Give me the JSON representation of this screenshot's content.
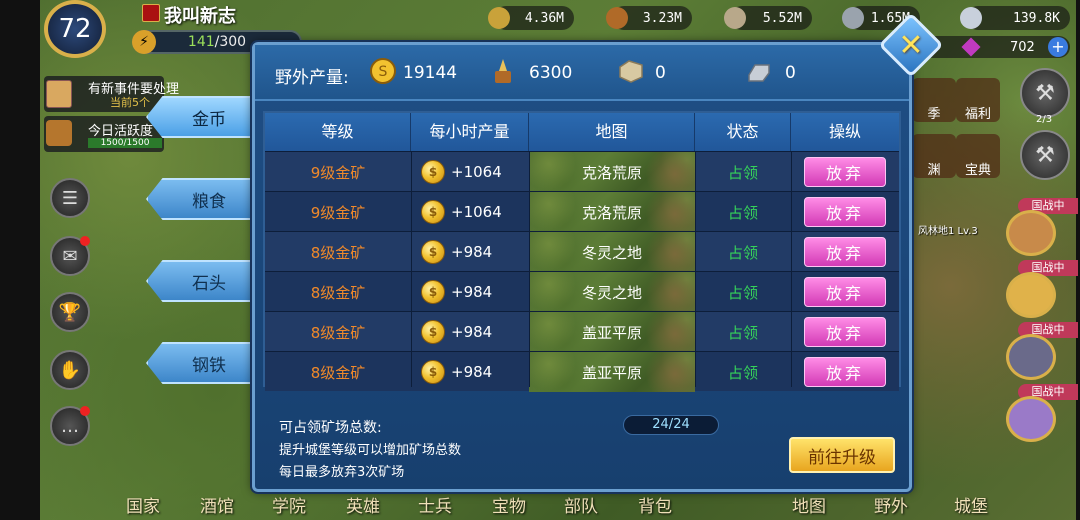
{
  "player": {
    "level": "72",
    "name": "我叫新志",
    "energy_current": "141",
    "energy_max": "/300"
  },
  "resources": [
    {
      "name": "gold",
      "value": "4.36M"
    },
    {
      "name": "food",
      "value": "3.23M"
    },
    {
      "name": "stone",
      "value": "5.52M"
    },
    {
      "name": "iron",
      "value": "1.65M"
    },
    {
      "name": "silver",
      "value": "139.8K"
    }
  ],
  "gems": "702",
  "left_panel": {
    "event_title": "有新事件要处理",
    "event_sub": "当前5个",
    "activity_title": "今日活跃度",
    "activity_progress": "1500/1500"
  },
  "tabs": [
    {
      "label": "金币"
    },
    {
      "label": "粮食"
    },
    {
      "label": "石头"
    },
    {
      "label": "钢铁"
    }
  ],
  "right_panel": {
    "icon_a": "季",
    "icon_b": "福利",
    "icon_c": "渊",
    "icon_d": "宝典",
    "page": "2/3",
    "map_label": "风林地1 Lv.3",
    "war_tag": "国战中"
  },
  "dialog": {
    "header_label": "野外产量:",
    "gold": "19144",
    "food": "6300",
    "stone": "0",
    "iron": "0",
    "columns": [
      "等级",
      "每小时产量",
      "地图",
      "状态",
      "操纵"
    ],
    "rows": [
      {
        "level": "9级金矿",
        "prod": "+1064",
        "map": "克洛荒原",
        "status": "占领",
        "action": "放弃"
      },
      {
        "level": "9级金矿",
        "prod": "+1064",
        "map": "克洛荒原",
        "status": "占领",
        "action": "放弃"
      },
      {
        "level": "8级金矿",
        "prod": "+984",
        "map": "冬灵之地",
        "status": "占领",
        "action": "放弃"
      },
      {
        "level": "8级金矿",
        "prod": "+984",
        "map": "冬灵之地",
        "status": "占领",
        "action": "放弃"
      },
      {
        "level": "8级金矿",
        "prod": "+984",
        "map": "盖亚平原",
        "status": "占领",
        "action": "放弃"
      },
      {
        "level": "8级金矿",
        "prod": "+984",
        "map": "盖亚平原",
        "status": "占领",
        "action": "放弃"
      }
    ],
    "footer_label": "可占领矿场总数:",
    "capacity": "24/24",
    "tip1": "提升城堡等级可以增加矿场总数",
    "tip2": "每日最多放弃3次矿场",
    "upgrade_label": "前往升级"
  },
  "bottom_nav": [
    "国家",
    "酒馆",
    "学院",
    "英雄",
    "士兵",
    "宝物",
    "部队",
    "背包",
    "地图",
    "野外",
    "城堡"
  ],
  "colors": {
    "accent_gold": "#f2c230",
    "level_orange": "#f0892a",
    "status_green": "#35d35a",
    "abandon_pink": "#d23ab5",
    "dialog_blue": "#1f4f86"
  }
}
